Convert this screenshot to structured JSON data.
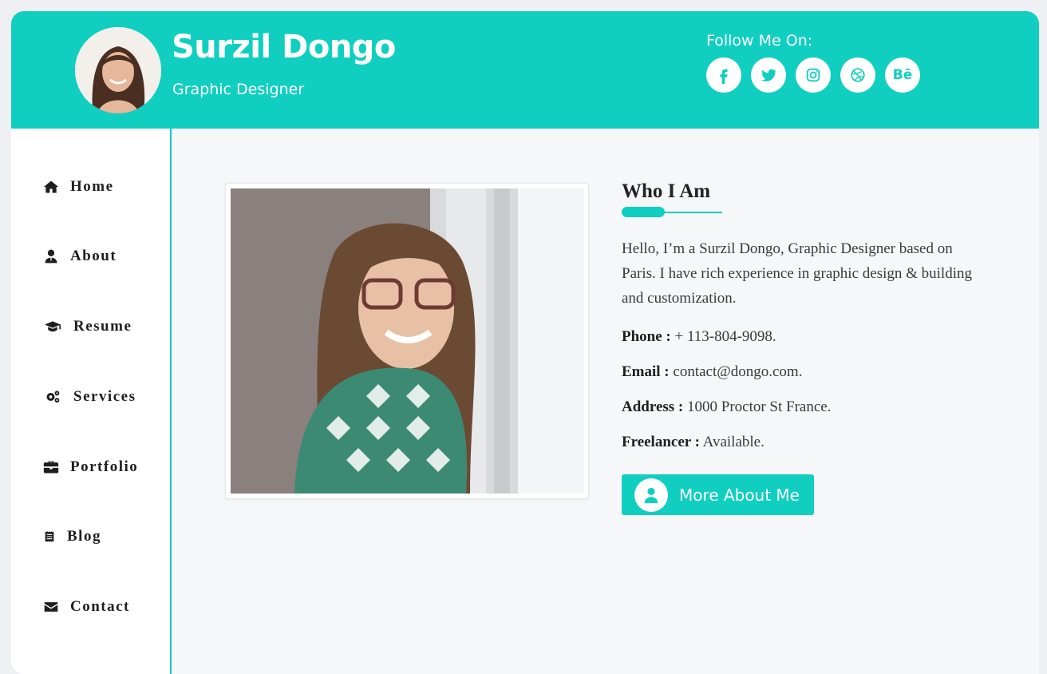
{
  "header": {
    "name": "Surzil Dongo",
    "role": "Graphic Designer",
    "follow_label": "Follow Me On:",
    "socials": [
      {
        "icon": "facebook-icon"
      },
      {
        "icon": "twitter-icon"
      },
      {
        "icon": "instagram-icon"
      },
      {
        "icon": "dribbble-icon"
      },
      {
        "icon": "behance-icon",
        "text": "Bē"
      }
    ]
  },
  "sidebar": {
    "items": [
      {
        "label": "Home",
        "icon": "home-icon"
      },
      {
        "label": "About",
        "icon": "user-icon"
      },
      {
        "label": "Resume",
        "icon": "graduation-cap-icon"
      },
      {
        "label": "Services",
        "icon": "gears-icon"
      },
      {
        "label": "Portfolio",
        "icon": "briefcase-icon"
      },
      {
        "label": "Blog",
        "icon": "receipt-icon"
      },
      {
        "label": "Contact",
        "icon": "envelope-icon"
      }
    ]
  },
  "about": {
    "title": "Who I Am",
    "bio": "Hello, I’m a Surzil Dongo, Graphic Designer based on Paris. I have rich experience in graphic design & building and customization.",
    "phone_label": "Phone :",
    "phone": "+ 113-804-9098.",
    "email_label": "Email :",
    "email": "contact@dongo.com.",
    "address_label": "Address :",
    "address": "1000 Proctor St France.",
    "freelancer_label": "Freelancer :",
    "freelancer": "Available.",
    "button_label": "More About Me"
  },
  "colors": {
    "accent": "#10cfc0",
    "background": "#f6f7f9",
    "text": "#3a3a3a"
  }
}
